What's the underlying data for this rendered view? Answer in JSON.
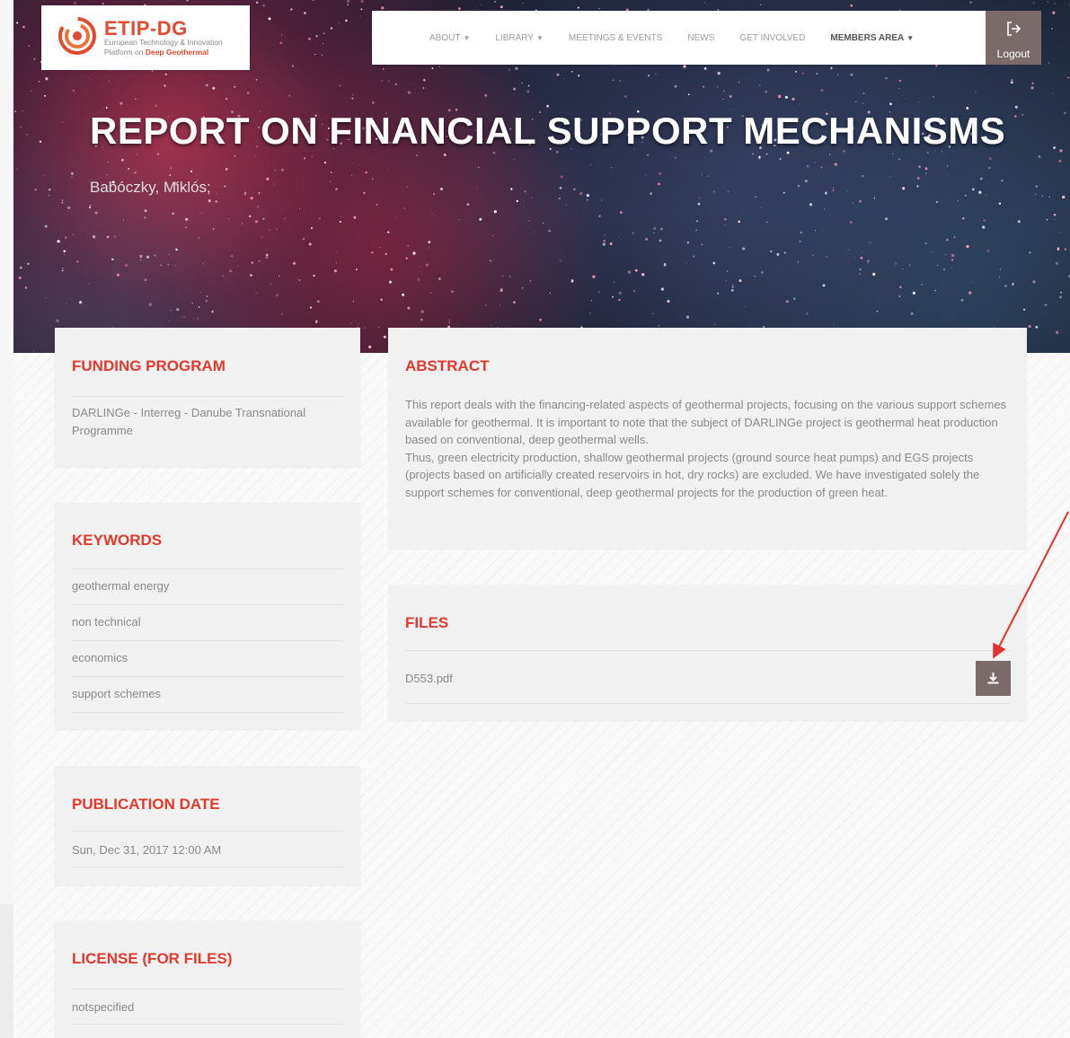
{
  "logo": {
    "name": "ETIP-DG",
    "tagline_line1": "European Technology & Innovation",
    "tagline_line2_prefix": "Platform on ",
    "tagline_line2_bold": "Deep Geothermal"
  },
  "nav": {
    "items": [
      {
        "label": "ABOUT",
        "dropdown": true
      },
      {
        "label": "LIBRARY",
        "dropdown": true
      },
      {
        "label": "MEETINGS & EVENTS",
        "dropdown": false
      },
      {
        "label": "NEWS",
        "dropdown": false
      },
      {
        "label": "GET INVOLVED",
        "dropdown": false
      },
      {
        "label": "MEMBERS AREA",
        "dropdown": true
      }
    ],
    "logout_label": "Logout"
  },
  "header": {
    "title": "REPORT ON FINANCIAL SUPPORT MECHANISMS",
    "authors": "Babóczky, Miklós;"
  },
  "funding": {
    "title": "FUNDING PROGRAM",
    "value": "DARLINGe - Interreg - Danube Transnational Programme"
  },
  "keywords": {
    "title": "KEYWORDS",
    "items": [
      "geothermal energy",
      "non technical",
      "economics",
      "support schemes"
    ]
  },
  "publication": {
    "title": "PUBLICATION DATE",
    "value": "Sun, Dec 31, 2017 12:00 AM"
  },
  "license": {
    "title": "LICENSE (FOR FILES)",
    "value": "notspecified"
  },
  "abstract": {
    "title": "ABSTRACT",
    "paragraph1": "This report deals with the financing-related aspects of geothermal projects, focusing on the various support schemes available for geothermal. It is important to note that the subject of DARLINGe project is geothermal heat production based on conventional, deep geothermal wells.",
    "paragraph2": "Thus, green electricity production, shallow geothermal projects (ground source heat pumps) and EGS projects (projects based on artificially created reservoirs in hot, dry rocks) are excluded. We have investigated solely the support schemes for conventional, deep geothermal projects for the production of green heat."
  },
  "files": {
    "title": "FILES",
    "items": [
      {
        "name": "D553.pdf",
        "action_icon": "download-icon"
      }
    ]
  },
  "colors": {
    "accent": "#e03a2f",
    "button": "#7a6a6a",
    "annotation_arrow": "#e2322d"
  },
  "icons": [
    "logo-swirl-icon",
    "logout-icon",
    "download-icon",
    "caret-down-icon"
  ]
}
